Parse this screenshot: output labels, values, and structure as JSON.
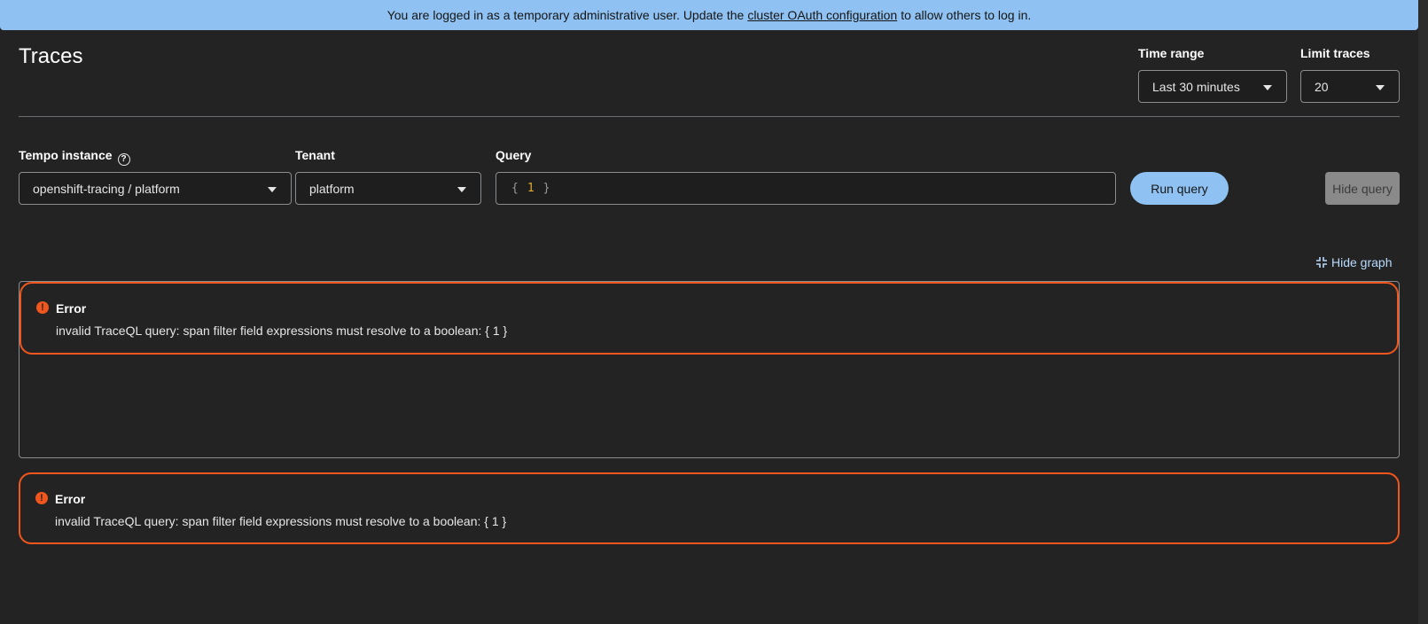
{
  "banner": {
    "text_before": "You are logged in as a temporary administrative user. Update the",
    "link": "cluster OAuth configuration",
    "text_after": "to allow others to log in."
  },
  "page": {
    "title": "Traces"
  },
  "time_range": {
    "label": "Time range",
    "value": "Last 30 minutes"
  },
  "limit_traces": {
    "label": "Limit traces",
    "value": "20"
  },
  "tempo_instance": {
    "label": "Tempo instance",
    "value": "openshift-tracing / platform"
  },
  "tenant": {
    "label": "Tenant",
    "value": "platform"
  },
  "query": {
    "label": "Query",
    "open": "{",
    "number": "1",
    "close": "}"
  },
  "actions": {
    "run_query": "Run query",
    "hide_query": "Hide query",
    "hide_graph": "Hide graph"
  },
  "errors": [
    {
      "title": "Error",
      "message": "invalid TraceQL query: span filter field expressions must resolve to a boolean: { 1 }"
    },
    {
      "title": "Error",
      "message": "invalid TraceQL query: span filter field expressions must resolve to a boolean: { 1 }"
    }
  ],
  "colors": {
    "accent": "#8fc2f2",
    "error": "#f0561d",
    "background": "#232323"
  }
}
